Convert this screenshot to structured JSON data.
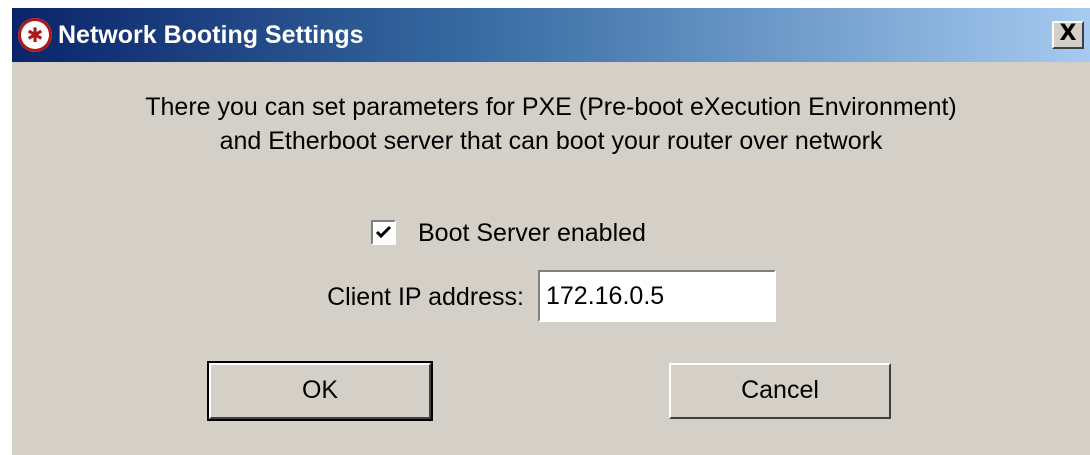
{
  "window": {
    "title": "Network Booting Settings",
    "close_glyph": "X",
    "icon_glyph": "✱"
  },
  "description": {
    "line1": "There you can set parameters for PXE (Pre-boot eXecution Environment)",
    "line2": "and Etherboot server that can boot your router over network"
  },
  "boot_server": {
    "label": "Boot Server enabled",
    "checked": true
  },
  "client_ip": {
    "label": "Client IP address:",
    "value": "172.16.0.5"
  },
  "buttons": {
    "ok_label": "OK",
    "cancel_label": "Cancel"
  },
  "colors": {
    "face": "#d4d0c8",
    "title_start": "#0a246a",
    "title_end": "#a6caf0",
    "icon_red": "#b01818"
  }
}
